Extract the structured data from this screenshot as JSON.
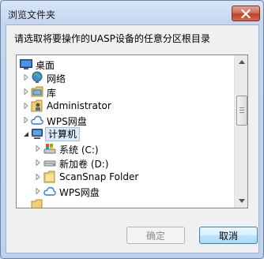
{
  "window": {
    "title": "浏览文件夹"
  },
  "prompt": "请选取将要操作的UASP设备的任意分区根目录",
  "tree": [
    {
      "label": "桌面",
      "icon": "desktop-icon",
      "expander": "none",
      "selected": false
    },
    {
      "label": "网络",
      "icon": "network-icon",
      "expander": "collapsed",
      "selected": false
    },
    {
      "label": "库",
      "icon": "library-icon",
      "expander": "collapsed",
      "selected": false
    },
    {
      "label": "Administrator",
      "icon": "user-folder-icon",
      "expander": "collapsed",
      "selected": false
    },
    {
      "label": "WPS网盘",
      "icon": "cloud-icon",
      "expander": "collapsed",
      "selected": false
    },
    {
      "label": "计算机",
      "icon": "computer-icon",
      "expander": "expanded",
      "selected": true
    },
    {
      "label": "系统 (C:)",
      "icon": "system-drive-icon",
      "expander": "collapsed",
      "selected": false
    },
    {
      "label": "新加卷 (D:)",
      "icon": "drive-icon",
      "expander": "collapsed",
      "selected": false
    },
    {
      "label": "ScanSnap Folder",
      "icon": "folder-icon",
      "expander": "collapsed",
      "selected": false
    },
    {
      "label": "WPS网盘",
      "icon": "cloud-icon",
      "expander": "collapsed",
      "selected": false
    },
    {
      "label": "",
      "icon": "folder-icon",
      "expander": "none",
      "selected": false
    }
  ],
  "buttons": {
    "ok": "确定",
    "cancel": "取消"
  },
  "colors": {
    "selection_bg": "#dceaf8",
    "selection_border": "#99c2ec",
    "close_button": "#c7503a"
  }
}
